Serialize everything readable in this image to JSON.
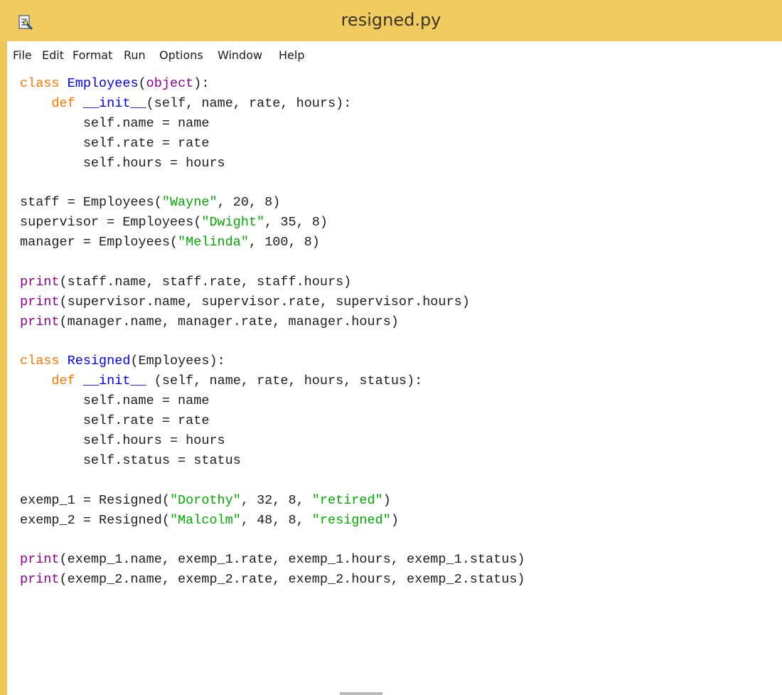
{
  "window": {
    "title": "resigned.py"
  },
  "menu": [
    "File",
    "Edit",
    "Format",
    "Run",
    "Options",
    "Window",
    "Help"
  ],
  "code_lines": [
    [
      [
        "kw",
        "class "
      ],
      [
        "def",
        "Employees"
      ],
      [
        "",
        "("
      ],
      [
        "bi",
        "object"
      ],
      [
        "",
        "):"
      ]
    ],
    [
      [
        "",
        "    "
      ],
      [
        "kw",
        "def "
      ],
      [
        "def",
        "__init__"
      ],
      [
        "",
        "(self, name, rate, hours):"
      ]
    ],
    [
      [
        "",
        "        self.name = name"
      ]
    ],
    [
      [
        "",
        "        self.rate = rate"
      ]
    ],
    [
      [
        "",
        "        self.hours = hours"
      ]
    ],
    [],
    [
      [
        "",
        "staff = Employees("
      ],
      [
        "str",
        "\"Wayne\""
      ],
      [
        "",
        ", 20, 8)"
      ]
    ],
    [
      [
        "",
        "supervisor = Employees("
      ],
      [
        "str",
        "\"Dwight\""
      ],
      [
        "",
        ", 35, 8)"
      ]
    ],
    [
      [
        "",
        "manager = Employees("
      ],
      [
        "str",
        "\"Melinda\""
      ],
      [
        "",
        ", 100, 8)"
      ]
    ],
    [],
    [
      [
        "bi",
        "print"
      ],
      [
        "",
        "(staff.name, staff.rate, staff.hours)"
      ]
    ],
    [
      [
        "bi",
        "print"
      ],
      [
        "",
        "(supervisor.name, supervisor.rate, supervisor.hours)"
      ]
    ],
    [
      [
        "bi",
        "print"
      ],
      [
        "",
        "(manager.name, manager.rate, manager.hours)"
      ]
    ],
    [],
    [
      [
        "kw",
        "class "
      ],
      [
        "def",
        "Resigned"
      ],
      [
        "",
        "(Employees):"
      ]
    ],
    [
      [
        "",
        "    "
      ],
      [
        "kw",
        "def "
      ],
      [
        "def",
        "__init__"
      ],
      [
        "",
        " (self, name, rate, hours, status):"
      ]
    ],
    [
      [
        "",
        "        self.name = name"
      ]
    ],
    [
      [
        "",
        "        self.rate = rate"
      ]
    ],
    [
      [
        "",
        "        self.hours = hours"
      ]
    ],
    [
      [
        "",
        "        self.status = status"
      ]
    ],
    [],
    [
      [
        "",
        "exemp_1 = Resigned("
      ],
      [
        "str",
        "\"Dorothy\""
      ],
      [
        "",
        ", 32, 8, "
      ],
      [
        "str",
        "\"retired\""
      ],
      [
        "",
        ")"
      ]
    ],
    [
      [
        "",
        "exemp_2 = Resigned("
      ],
      [
        "str",
        "\"Malcolm\""
      ],
      [
        "",
        ", 48, 8, "
      ],
      [
        "str",
        "\"resigned\""
      ],
      [
        "",
        ")"
      ]
    ],
    [],
    [
      [
        "bi",
        "print"
      ],
      [
        "",
        "(exemp_1.name, exemp_1.rate, exemp_1.hours, exemp_1.status)"
      ]
    ],
    [
      [
        "bi",
        "print"
      ],
      [
        "",
        "(exemp_2.name, exemp_2.rate, exemp_2.hours, exemp_2.status)"
      ]
    ]
  ],
  "syntax_colors": {
    "keyword": "#ff7700",
    "definition": "#0000ff",
    "builtin": "#900090",
    "string": "#00aa00",
    "titlebar": "#f0cb5f"
  }
}
